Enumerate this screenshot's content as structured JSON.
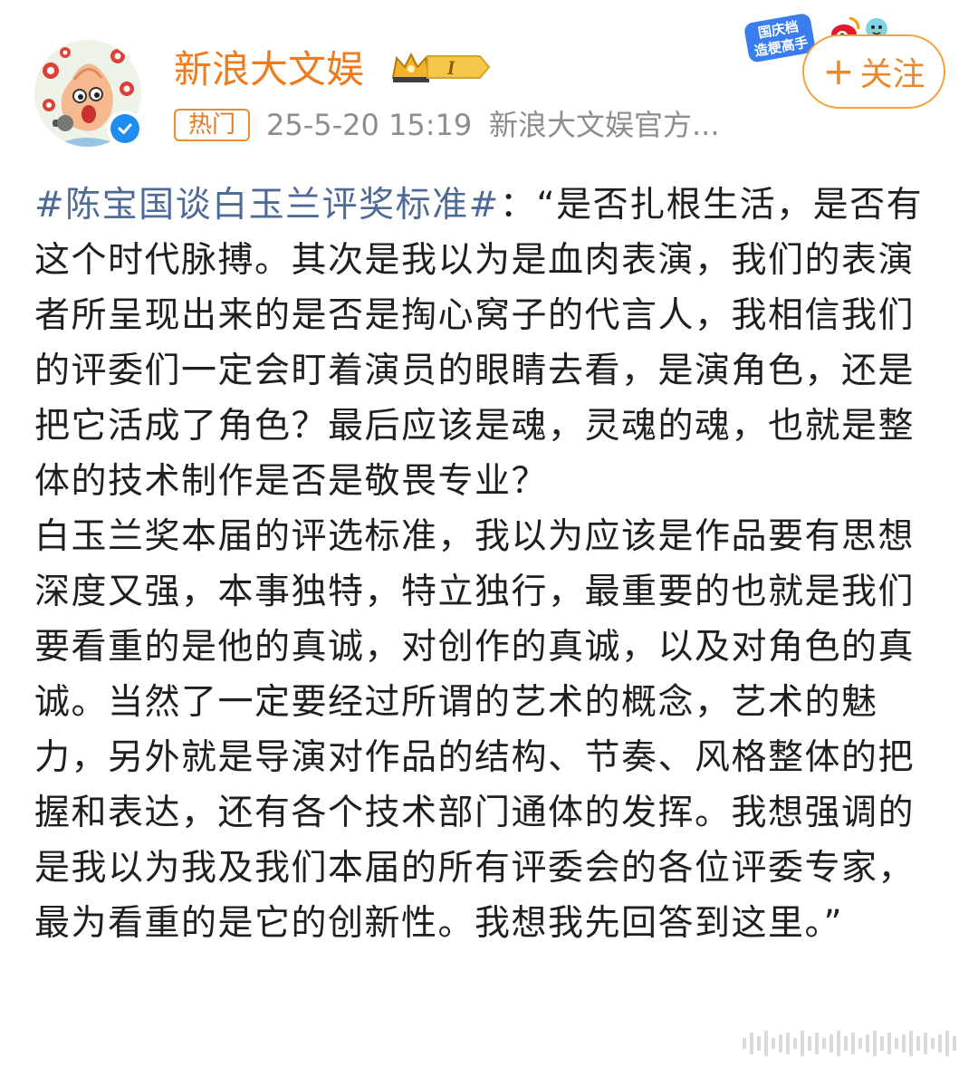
{
  "author": {
    "name": "新浪大文娱",
    "level_badge_text": "I",
    "verified": true
  },
  "meta": {
    "hot_tag": "热门",
    "timestamp": "25-5-20 15:19",
    "source": "新浪大文娱官方..."
  },
  "follow_button": {
    "plus": "+",
    "label": "关注"
  },
  "event_sticker": {
    "line1": "国庆档",
    "line2": "造梗高手"
  },
  "post": {
    "hashtag": "#陈宝国谈白玉兰评奖标准#",
    "paragraph1_rest": "：“是否扎根生活，是否有这个时代脉搏。其次是我以为是血肉表演，我们的表演者所呈现出来的是否是掏心窝子的代言人，我相信我们的评委们一定会盯着演员的眼睛去看，是演角色，还是把它活成了角色？最后应该是魂，灵魂的魂，也就是整体的技术制作是否是敬畏专业？",
    "paragraph2": "白玉兰奖本届的评选标准，我以为应该是作品要有思想深度又强，本事独特，特立独行，最重要的也就是我们要看重的是他的真诚，对创作的真诚，以及对角色的真诚。当然了一定要经过所谓的艺术的概念，艺术的魅力，另外就是导演对作品的结构、节奏、风格整体的把握和表达，还有各个技术部门通体的发挥。我想强调的是我以为我及我们本届的所有评委会的各位评委专家，最为看重的是它的创新性。我想我先回答到这里。”"
  },
  "colors": {
    "username": "#f07b1d",
    "hashtag": "#4e6b97",
    "meta_text": "#8d8d8d",
    "follow_accent": "#f1a23c",
    "verified_blue": "#1f8cf2"
  },
  "icons": [
    "avatar-cartoon",
    "verified-icon",
    "crown-icon",
    "plus-icon",
    "weibo-logo-icon",
    "watermark-icon"
  ]
}
